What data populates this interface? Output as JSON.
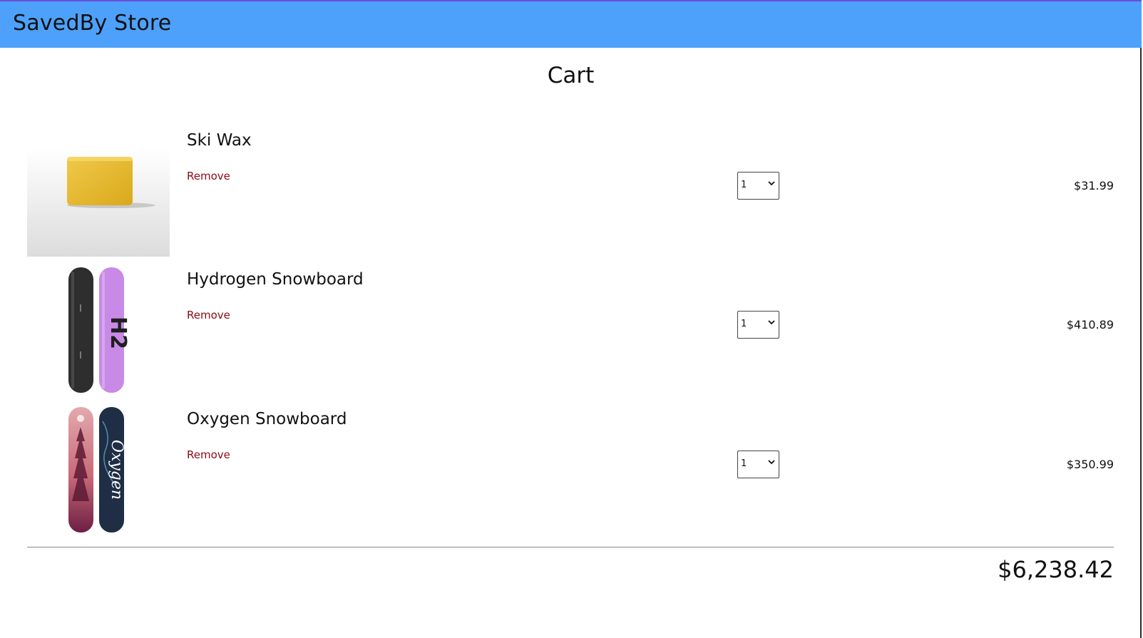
{
  "header": {
    "brand": "SavedBy Store"
  },
  "cart": {
    "title": "Cart",
    "items": [
      {
        "name": "Ski Wax",
        "remove_label": "Remove",
        "quantity": "1",
        "price": "$31.99",
        "image_icon": "ski-wax-image"
      },
      {
        "name": "Hydrogen Snowboard",
        "remove_label": "Remove",
        "quantity": "1",
        "price": "$410.89",
        "image_icon": "hydrogen-snowboard-image"
      },
      {
        "name": "Oxygen Snowboard",
        "remove_label": "Remove",
        "quantity": "1",
        "price": "$350.99",
        "image_icon": "oxygen-snowboard-image"
      }
    ],
    "total": "$6,238.42"
  },
  "colors": {
    "header_bg": "#4da1fb",
    "remove_link": "#8b0a14"
  }
}
